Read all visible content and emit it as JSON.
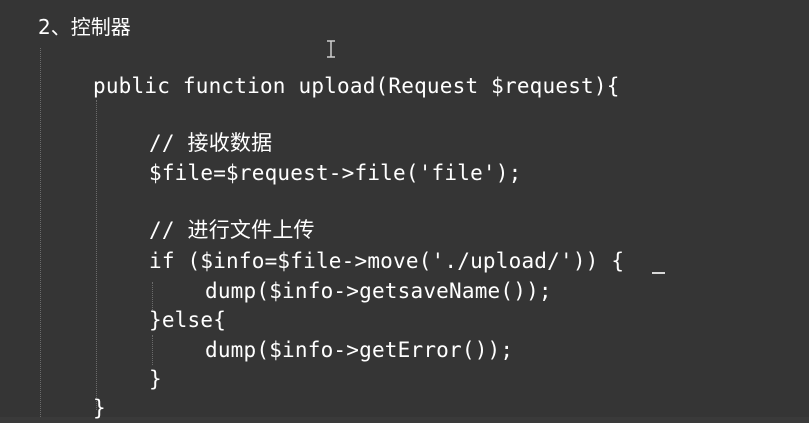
{
  "heading": "2、控制器",
  "code": {
    "lines": [
      "public function upload(Request $request){",
      "// 接收数据",
      "$file=$request->file('file');",
      "// 进行文件上传",
      "if ($info=$file->move('./upload/')) {",
      "dump($info->getsaveName());",
      "}else{",
      "dump($info->getError());",
      "}",
      "}"
    ]
  },
  "colors": {
    "background": "#353535",
    "text": "#ffffff",
    "indent_guide": "#6b6b6b"
  },
  "icons": {
    "cursor": "text-cursor-ibeam-icon"
  }
}
